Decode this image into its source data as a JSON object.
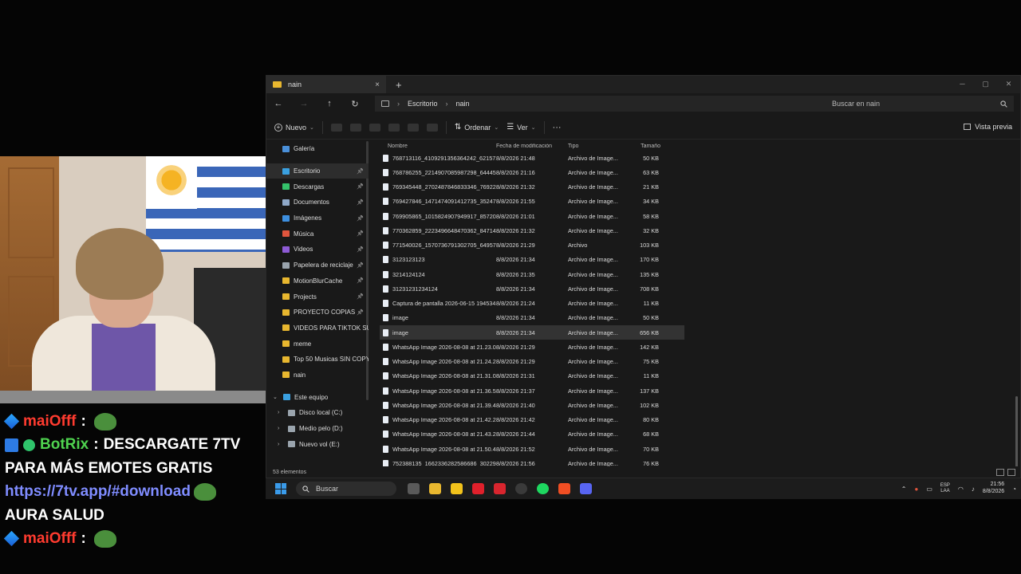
{
  "chat": {
    "line1": {
      "user": "maiOfff",
      "colon": ":"
    },
    "line2": {
      "user": "BotRix",
      "colon": ":",
      "msg": "DESCARGATE 7TV"
    },
    "line3": {
      "msg": "PARA MÁS EMOTES GRATIS"
    },
    "line4": {
      "link": "https://7tv.app/#download"
    },
    "line5": {
      "msg": "AURA SALUD"
    },
    "line6": {
      "user": "maiOfff",
      "colon": ":"
    }
  },
  "explorer": {
    "tab_title": "nain",
    "tab_close": "×",
    "new_tab": "+",
    "window_controls": [
      "─",
      "▢",
      "✕"
    ],
    "nav": {
      "back": "←",
      "forward": "→",
      "up": "↑",
      "refresh": "↻"
    },
    "breadcrumb": [
      "Escritorio",
      "nain"
    ],
    "breadcrumb_sep": "›",
    "search_placeholder": "Buscar en nain",
    "commands": {
      "new": "Nuevo",
      "sort": "Ordenar",
      "view": "Ver",
      "more": "···",
      "preview": "Vista previa"
    },
    "sidebar": [
      {
        "label": "Galería",
        "icon": "gallery-icon",
        "color": "#4a90d9"
      },
      {
        "label": "Escritorio",
        "icon": "desktop-icon",
        "color": "#3aa0e0",
        "pinned": true,
        "active": true
      },
      {
        "label": "Descargas",
        "icon": "download-icon",
        "color": "#35c26b",
        "pinned": true
      },
      {
        "label": "Documentos",
        "icon": "document-icon",
        "color": "#8fa8c8",
        "pinned": true
      },
      {
        "label": "Imágenes",
        "icon": "pictures-icon",
        "color": "#3d8fe0",
        "pinned": true
      },
      {
        "label": "Música",
        "icon": "music-icon",
        "color": "#e0553d",
        "pinned": true
      },
      {
        "label": "Videos",
        "icon": "videos-icon",
        "color": "#8e5bd6",
        "pinned": true
      },
      {
        "label": "Papelera de reciclaje",
        "icon": "recycle-bin-icon",
        "color": "#9aa4ad",
        "pinned": true
      },
      {
        "label": "MotionBlurCache",
        "icon": "folder-icon",
        "color": "#e8b72f",
        "pinned": true
      },
      {
        "label": "Projects",
        "icon": "folder-icon",
        "color": "#e8b72f",
        "pinned": true
      },
      {
        "label": "PROYECTO COPIAS",
        "icon": "folder-icon",
        "color": "#e8b72f",
        "pinned": true
      },
      {
        "label": "VIDEOS PARA TIKTOK SUBI",
        "icon": "folder-icon",
        "color": "#e8b72f"
      },
      {
        "label": "meme",
        "icon": "folder-icon",
        "color": "#e8b72f"
      },
      {
        "label": "Top 50 Musicas SIN COPYRI",
        "icon": "folder-icon",
        "color": "#e8b72f"
      },
      {
        "label": "nain",
        "icon": "folder-icon",
        "color": "#e8b72f"
      }
    ],
    "this_pc": {
      "label": "Este equipo",
      "drives": [
        "Disco local (C:)",
        "Medio pelo (D:)",
        "Nuevo vol (E:)"
      ]
    },
    "columns": {
      "name": "Nombre",
      "date": "Fecha de modificación",
      "type": "Tipo",
      "size": "Tamaño"
    },
    "files": [
      {
        "name": "768713116_4109291356364242_6215720...",
        "date": "8/8/2026 21:48",
        "type": "Archivo de Image...",
        "size": "50 KB"
      },
      {
        "name": "768786255_2214907085987298_6444504...",
        "date": "8/8/2026 21:16",
        "type": "Archivo de Image...",
        "size": "63 KB"
      },
      {
        "name": "769345448_2702487846833346_7692220...",
        "date": "8/8/2026 21:32",
        "type": "Archivo de Image...",
        "size": "21 KB"
      },
      {
        "name": "769427846_1471474091412735_3524711...",
        "date": "8/8/2026 21:55",
        "type": "Archivo de Image...",
        "size": "34 KB"
      },
      {
        "name": "769905865_1015824907949917_8572058...",
        "date": "8/8/2026 21:01",
        "type": "Archivo de Image...",
        "size": "58 KB"
      },
      {
        "name": "770362859_2223496648470362_8471430...",
        "date": "8/8/2026 21:32",
        "type": "Archivo de Image...",
        "size": "32 KB"
      },
      {
        "name": "771540026_1570736791302705_6495761...",
        "date": "8/8/2026 21:29",
        "type": "Archivo",
        "size": "103 KB"
      },
      {
        "name": "3123123123",
        "date": "8/8/2026 21:34",
        "type": "Archivo de Image...",
        "size": "170 KB"
      },
      {
        "name": "3214124124",
        "date": "8/8/2026 21:35",
        "type": "Archivo de Image...",
        "size": "135 KB"
      },
      {
        "name": "31231231234124",
        "date": "8/8/2026 21:34",
        "type": "Archivo de Image...",
        "size": "708 KB"
      },
      {
        "name": "Captura de pantalla 2026-06-15 1945341",
        "date": "8/8/2026 21:24",
        "type": "Archivo de Image...",
        "size": "11 KB"
      },
      {
        "name": "image",
        "date": "8/8/2026 21:34",
        "type": "Archivo de Image...",
        "size": "50 KB"
      },
      {
        "name": "image",
        "date": "8/8/2026 21:34",
        "type": "Archivo de Image...",
        "size": "656 KB",
        "selected": true
      },
      {
        "name": "WhatsApp Image 2026-08-08 at 21.23.05",
        "date": "8/8/2026 21:29",
        "type": "Archivo de Image...",
        "size": "142 KB"
      },
      {
        "name": "WhatsApp Image 2026-08-08 at 21.24.25",
        "date": "8/8/2026 21:29",
        "type": "Archivo de Image...",
        "size": "75 KB"
      },
      {
        "name": "WhatsApp Image 2026-08-08 at 21.31.08",
        "date": "8/8/2026 21:31",
        "type": "Archivo de Image...",
        "size": "11 KB"
      },
      {
        "name": "WhatsApp Image 2026-08-08 at 21.36.53",
        "date": "8/8/2026 21:37",
        "type": "Archivo de Image...",
        "size": "137 KB"
      },
      {
        "name": "WhatsApp Image 2026-08-08 at 21.39.47",
        "date": "8/8/2026 21:40",
        "type": "Archivo de Image...",
        "size": "102 KB"
      },
      {
        "name": "WhatsApp Image 2026-08-08 at 21.42.21",
        "date": "8/8/2026 21:42",
        "type": "Archivo de Image...",
        "size": "80 KB"
      },
      {
        "name": "WhatsApp Image 2026-08-08 at 21.43.20",
        "date": "8/8/2026 21:44",
        "type": "Archivo de Image...",
        "size": "68 KB"
      },
      {
        "name": "WhatsApp Image 2026-08-08 at 21.50.43",
        "date": "8/8/2026 21:52",
        "type": "Archivo de Image...",
        "size": "70 KB"
      },
      {
        "name": "752388135_1662336282586686_3022960...",
        "date": "8/8/2026 21:56",
        "type": "Archivo de Image...",
        "size": "76 KB"
      }
    ],
    "status": "53 elementos"
  },
  "taskbar": {
    "search": "Buscar",
    "apps": [
      {
        "name": "task-view-icon",
        "color": "#5a5a5a"
      },
      {
        "name": "file-explorer-icon",
        "color": "#e8b72f"
      },
      {
        "name": "sticky-app-icon",
        "color": "#f2c21b"
      },
      {
        "name": "opera-icon",
        "color": "#e0202b"
      },
      {
        "name": "wps-icon",
        "color": "#d9252e"
      },
      {
        "name": "obs-icon",
        "color": "#3a3a3a"
      },
      {
        "name": "spotify-icon",
        "color": "#1ed760"
      },
      {
        "name": "brave-icon",
        "color": "#f04e23"
      },
      {
        "name": "discord-icon",
        "color": "#5865f2"
      }
    ],
    "tray": {
      "lang1": "ESP",
      "lang2": "LAA",
      "time": "21:56",
      "date": "8/8/2026"
    }
  }
}
